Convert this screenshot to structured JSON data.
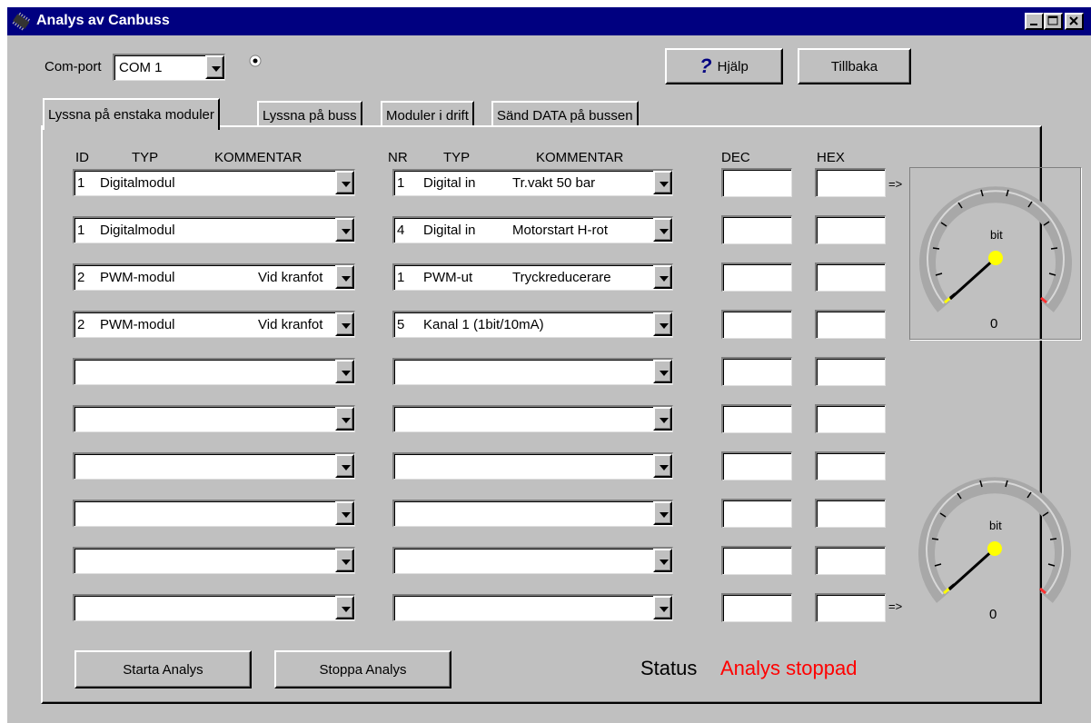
{
  "window": {
    "title": "Analys av Canbuss"
  },
  "toolbar": {
    "comport_label": "Com-port",
    "comport_value": "COM 1",
    "help_label": "Hjälp",
    "back_label": "Tillbaka"
  },
  "tabs": [
    {
      "label": "Lyssna på enstaka moduler",
      "active": true
    },
    {
      "label": "Lyssna på buss",
      "active": false
    },
    {
      "label": "Moduler i drift",
      "active": false
    },
    {
      "label": "Sänd DATA på bussen",
      "active": false
    }
  ],
  "headers": {
    "id": "ID",
    "typ1": "TYP",
    "kommentar1": "KOMMENTAR",
    "nr": "NR",
    "typ2": "TYP",
    "kommentar2": "KOMMENTAR",
    "dec": "DEC",
    "hex": "HEX"
  },
  "rows": [
    {
      "module": [
        "1",
        "Digitalmodul",
        ""
      ],
      "signal": [
        "1",
        "Digital in",
        "Tr.vakt 50 bar"
      ]
    },
    {
      "module": [
        "1",
        "Digitalmodul",
        ""
      ],
      "signal": [
        "4",
        "Digital in",
        "Motorstart H-rot"
      ]
    },
    {
      "module": [
        "2",
        "PWM-modul",
        "Vid kranfot"
      ],
      "signal": [
        "1",
        "PWM-ut",
        "Tryckreducerare"
      ]
    },
    {
      "module": [
        "2",
        "PWM-modul",
        "Vid kranfot"
      ],
      "signal": [
        "5",
        "Kanal 1 (1bit/10mA)",
        ""
      ]
    },
    {
      "module": [
        "",
        "",
        ""
      ],
      "signal": [
        "",
        "",
        ""
      ]
    },
    {
      "module": [
        "",
        "",
        ""
      ],
      "signal": [
        "",
        "",
        ""
      ]
    },
    {
      "module": [
        "",
        "",
        ""
      ],
      "signal": [
        "",
        "",
        ""
      ]
    },
    {
      "module": [
        "",
        "",
        ""
      ],
      "signal": [
        "",
        "",
        ""
      ]
    },
    {
      "module": [
        "",
        "",
        ""
      ],
      "signal": [
        "",
        "",
        ""
      ]
    },
    {
      "module": [
        "",
        "",
        ""
      ],
      "signal": [
        "",
        "",
        ""
      ]
    }
  ],
  "arrow_mark": "=>",
  "gauges": [
    {
      "unit": "bit",
      "value": "0"
    },
    {
      "unit": "bit",
      "value": "0"
    }
  ],
  "actions": {
    "start_label": "Starta Analys",
    "stop_label": "Stoppa Analys"
  },
  "status": {
    "label": "Status",
    "value": "Analys stoppad",
    "value_color": "#ff0000"
  },
  "colors": {
    "titlebar": "#000080",
    "face": "#c0c0c0",
    "needle_knob": "#ffff00"
  }
}
